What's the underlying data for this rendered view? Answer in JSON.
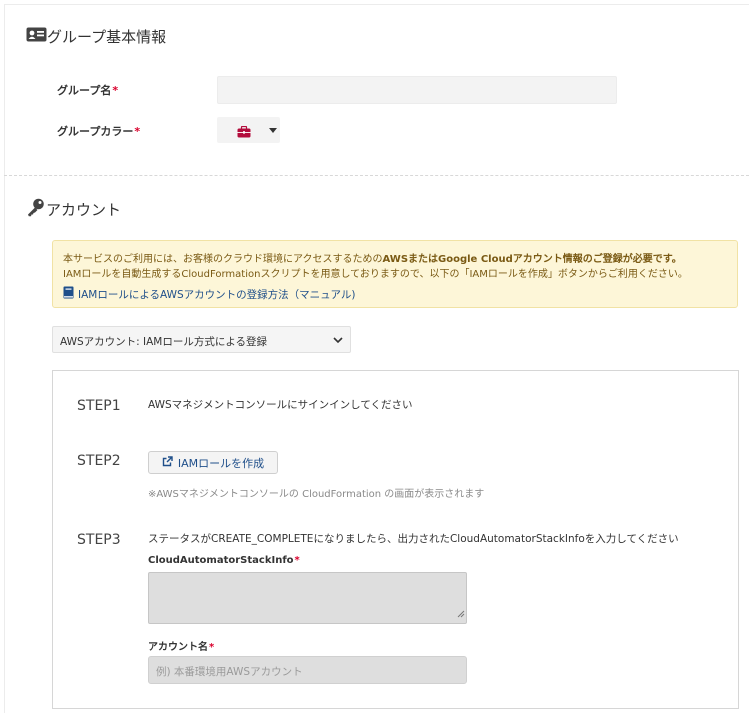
{
  "group_info": {
    "title": "グループ基本情報",
    "group_name_label": "グループ名",
    "group_color_label": "グループカラー",
    "required_mark": "*",
    "group_name_value": "",
    "swatch_color": "#b30c3c"
  },
  "account": {
    "title": "アカウント",
    "notice": {
      "line1_pre": "本サービスのご利用には、お客様のクラウド環境にアクセスするための",
      "line1_bold": "AWSまたはGoogle Cloudアカウント情報のご登録が必要です。",
      "line2": "IAMロールを自動生成するCloudFormationスクリプトを用意しておりますので、以下の「IAMロールを作成」ボタンからご利用ください。",
      "manual_link": "IAMロールによるAWSアカウントの登録方法（マニュアル)"
    },
    "method_select": "AWSアカウント: IAMロール方式による登録",
    "steps": {
      "step1_label": "STEP1",
      "step1_text": "AWSマネジメントコンソールにサインインしてください",
      "step2_label": "STEP2",
      "create_iam_button": "IAMロールを作成",
      "step2_note": "※AWSマネジメントコンソールの CloudFormation の画面が表示されます",
      "step3_label": "STEP3",
      "step3_text": "ステータスがCREATE_COMPLETEになりましたら、出力されたCloudAutomatorStackInfoを入力してください",
      "stackinfo_label": "CloudAutomatorStackInfo",
      "stackinfo_value": "",
      "account_name_label": "アカウント名",
      "account_name_placeholder": "例) 本番環境用AWSアカウント"
    }
  },
  "colors": {
    "required": "#d9002c",
    "link": "#1f4f8a",
    "notice_bg": "#fdf6d8",
    "notice_text": "#7a5a14"
  }
}
